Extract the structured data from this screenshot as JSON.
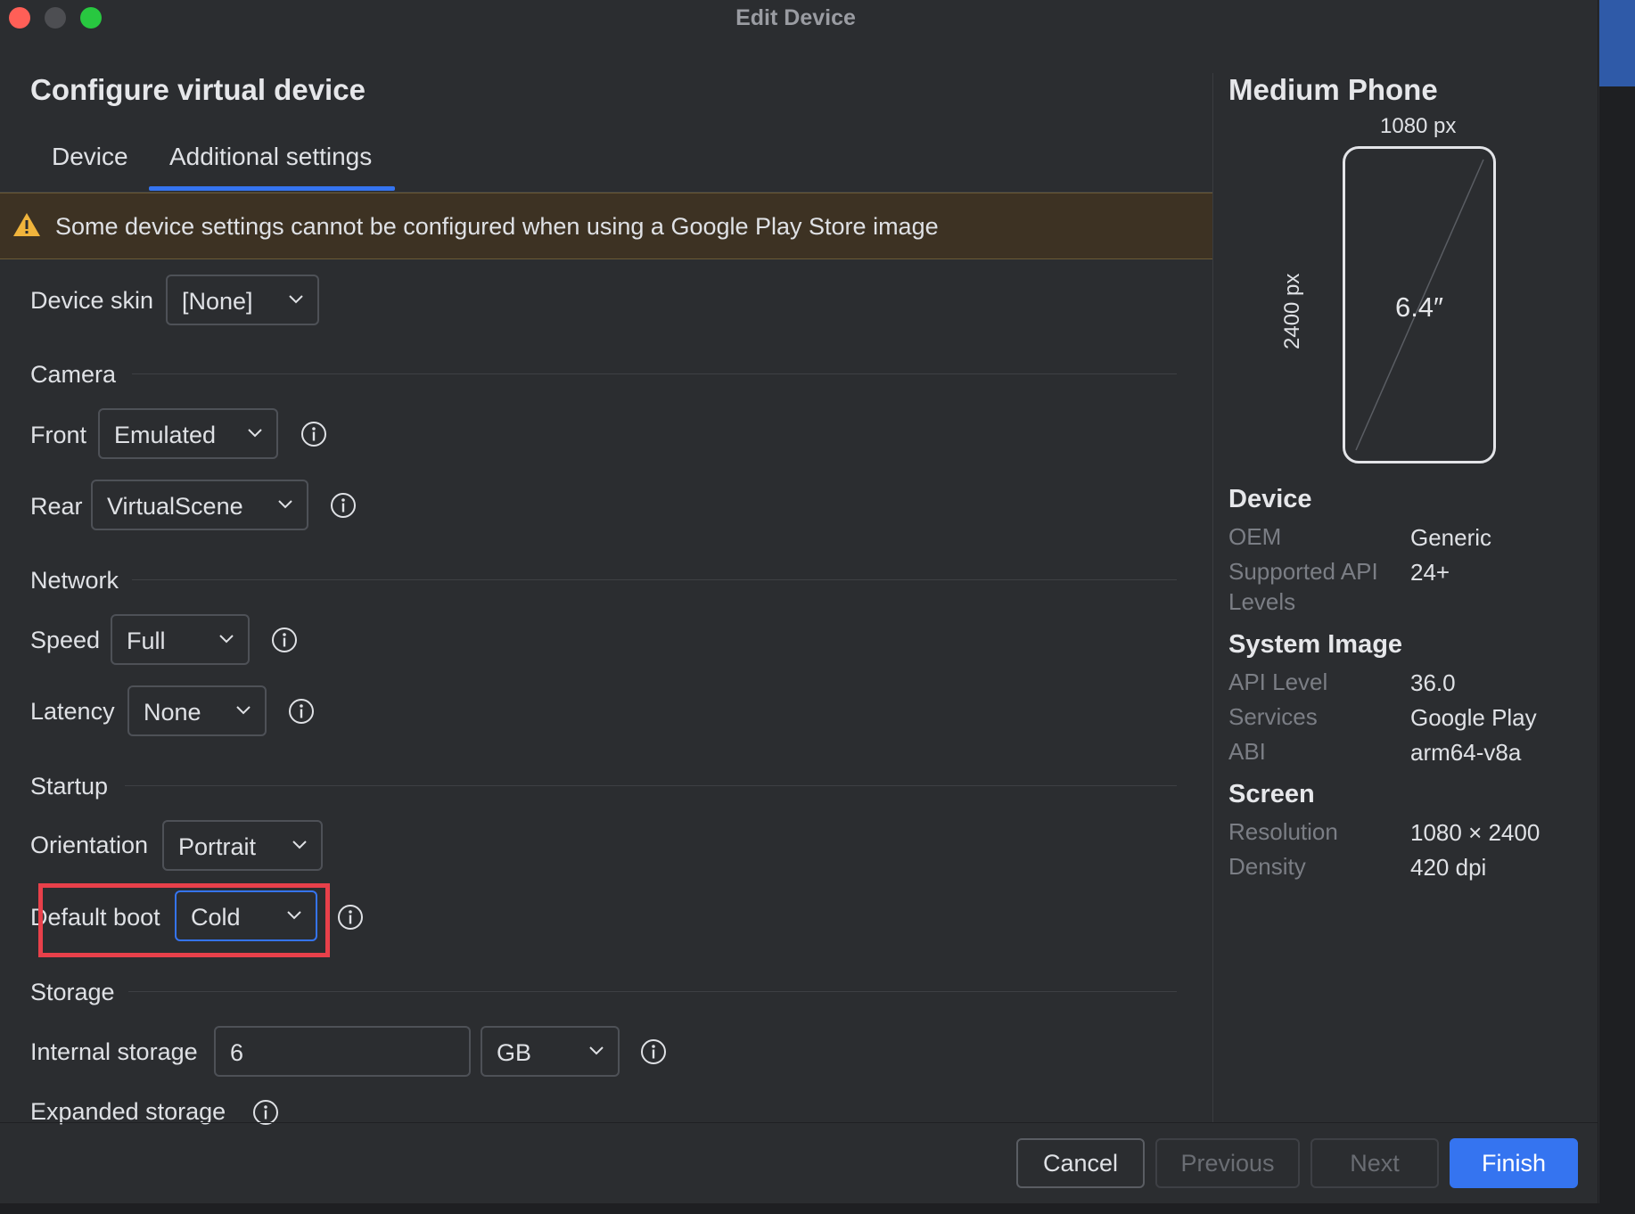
{
  "window": {
    "title": "Edit Device"
  },
  "header": {
    "title": "Configure virtual device"
  },
  "tabs": [
    {
      "label": "Device"
    },
    {
      "label": "Additional settings"
    }
  ],
  "active_tab": "Additional settings",
  "warning": {
    "text": "Some device settings cannot be configured when using a Google Play Store image"
  },
  "form": {
    "device_skin": {
      "label": "Device skin",
      "value": "[None]"
    },
    "camera": {
      "section": "Camera",
      "front": {
        "label": "Front",
        "value": "Emulated"
      },
      "rear": {
        "label": "Rear",
        "value": "VirtualScene"
      }
    },
    "network": {
      "section": "Network",
      "speed": {
        "label": "Speed",
        "value": "Full"
      },
      "latency": {
        "label": "Latency",
        "value": "None"
      }
    },
    "startup": {
      "section": "Startup",
      "orientation": {
        "label": "Orientation",
        "value": "Portrait"
      },
      "default_boot": {
        "label": "Default boot",
        "value": "Cold"
      }
    },
    "storage": {
      "section": "Storage",
      "internal": {
        "label": "Internal storage",
        "value": "6",
        "unit": "GB"
      },
      "expanded": {
        "label": "Expanded storage"
      }
    }
  },
  "preview": {
    "title": "Medium Phone",
    "width_label": "1080 px",
    "height_label": "2400 px",
    "size_label": "6.4″"
  },
  "details": {
    "device": {
      "heading": "Device",
      "oem": {
        "key": "OEM",
        "value": "Generic"
      },
      "api": {
        "key": "Supported API Levels",
        "value": "24+"
      }
    },
    "system_image": {
      "heading": "System Image",
      "api_level": {
        "key": "API Level",
        "value": "36.0"
      },
      "services": {
        "key": "Services",
        "value": "Google Play"
      },
      "abi": {
        "key": "ABI",
        "value": "arm64-v8a"
      }
    },
    "screen": {
      "heading": "Screen",
      "resolution": {
        "key": "Resolution",
        "value": "1080 × 2400"
      },
      "density": {
        "key": "Density",
        "value": "420 dpi"
      }
    }
  },
  "footer": {
    "cancel": "Cancel",
    "previous": "Previous",
    "next": "Next",
    "finish": "Finish"
  },
  "colors": {
    "accent": "#3574f0",
    "warning_bg": "#3d3223",
    "highlight": "#e8404a",
    "background": "#2b2d30"
  }
}
